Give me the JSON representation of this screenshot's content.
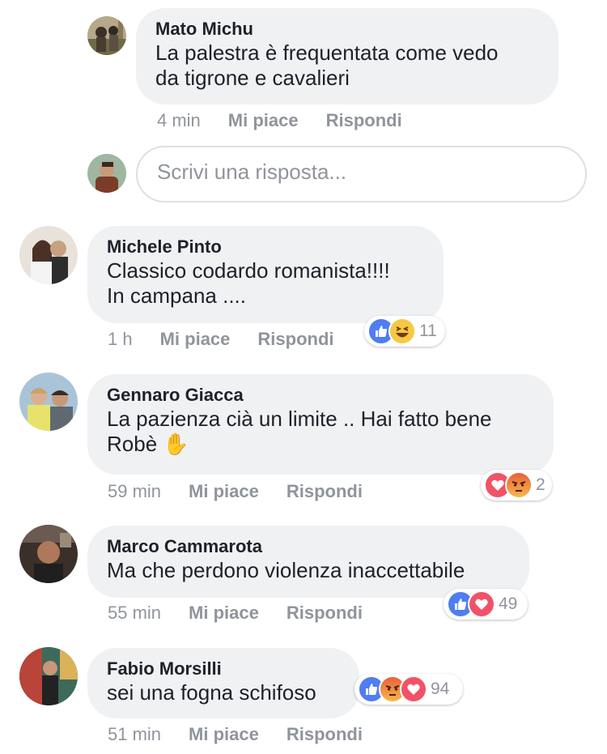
{
  "colors": {
    "bubble": "#f0f1f3",
    "meta": "#90949c",
    "like_blue": "#4f7df2",
    "love_red": "#f25268",
    "haha_yellow": "#f7c843"
  },
  "comments": [
    {
      "author": "Mato Michu",
      "lines": [
        "La palestra è frequentata come vedo",
        "da tigrone e cavalieri"
      ],
      "time": "4 min",
      "like": "Mi piace",
      "reply": "Rispondi",
      "reactions": [],
      "reaction_count": ""
    },
    {
      "author": "Michele Pinto",
      "lines": [
        "Classico codardo romanista!!!!",
        "In campana ...."
      ],
      "time": "1 h",
      "like": "Mi piace",
      "reply": "Rispondi",
      "reactions": [
        "like-icon",
        "haha-icon"
      ],
      "reaction_count": "11"
    },
    {
      "author": "Gennaro Giacca",
      "lines": [
        "La pazienza cià un limite .. Hai fatto bene",
        "Robè ✋"
      ],
      "time": "59 min",
      "like": "Mi piace",
      "reply": "Rispondi",
      "reactions": [
        "love-icon",
        "angry-icon"
      ],
      "reaction_count": "2"
    },
    {
      "author": "Marco Cammarota",
      "lines": [
        "Ma che perdono violenza inaccettabile"
      ],
      "time": "55 min",
      "like": "Mi piace",
      "reply": "Rispondi",
      "reactions": [
        "like-icon",
        "love-icon"
      ],
      "reaction_count": "49"
    },
    {
      "author": "Fabio Morsilli",
      "lines": [
        "sei una fogna schifoso"
      ],
      "time": "51 min",
      "like": "Mi piace",
      "reply": "Rispondi",
      "reactions": [
        "like-icon",
        "angry-icon",
        "love-icon"
      ],
      "reaction_count": "94"
    }
  ],
  "reply_box": {
    "placeholder": "Scrivi una risposta..."
  }
}
